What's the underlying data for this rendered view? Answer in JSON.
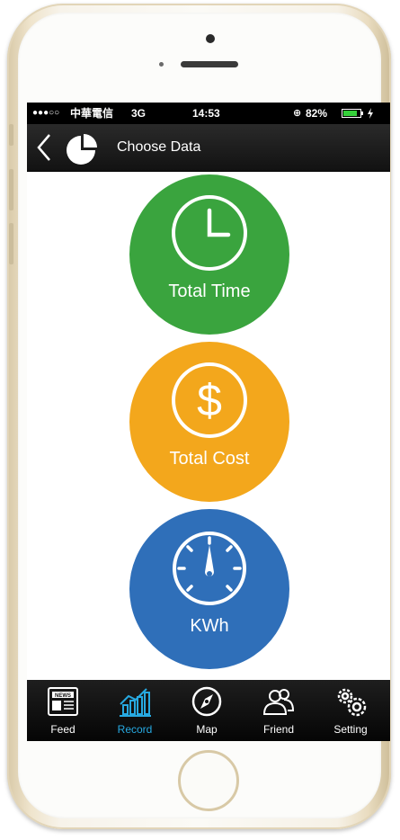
{
  "status_bar": {
    "signal": "●●●○○",
    "carrier": "中華電信",
    "network": "3G",
    "time": "14:53",
    "battery_percent": "82%",
    "battery_level": 0.82
  },
  "nav": {
    "title": "Choose Data",
    "back_icon": "chevron-left-icon",
    "logo_icon": "pie-chart-icon"
  },
  "options": [
    {
      "label": "Total Time",
      "icon": "clock-icon",
      "color": "#3aa43e"
    },
    {
      "label": "Total Cost",
      "icon": "dollar-icon",
      "color": "#f3a71c"
    },
    {
      "label": "KWh",
      "icon": "gauge-icon",
      "color": "#2f6fb9"
    }
  ],
  "tabs": [
    {
      "label": "Feed",
      "icon": "newspaper-icon",
      "active": false
    },
    {
      "label": "Record",
      "icon": "bar-chart-icon",
      "active": true
    },
    {
      "label": "Map",
      "icon": "compass-icon",
      "active": false
    },
    {
      "label": "Friend",
      "icon": "friends-icon",
      "active": false
    },
    {
      "label": "Setting",
      "icon": "gears-icon",
      "active": false
    }
  ],
  "colors": {
    "active_tab": "#27a9e1",
    "bar_background": "#111111",
    "phone_frame": "#efe4cc"
  }
}
